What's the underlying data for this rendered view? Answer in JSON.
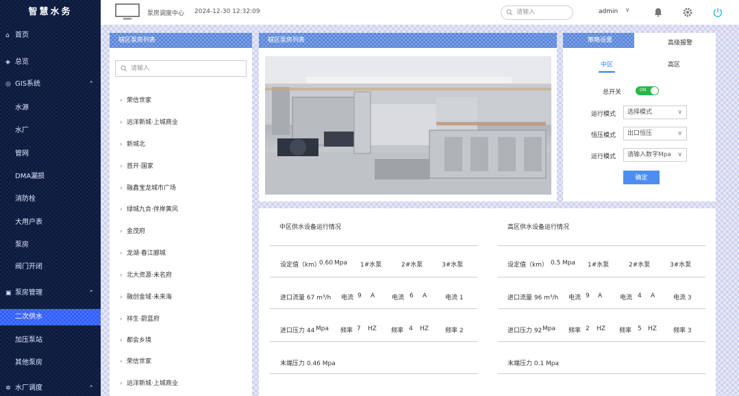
{
  "app": {
    "title": "智慧水务"
  },
  "sidebar": {
    "items": [
      {
        "label": "首页",
        "icon": "home-icon",
        "glyph": "⌂"
      },
      {
        "label": "总览",
        "icon": "layers-icon",
        "glyph": "◈"
      },
      {
        "label": "GIS系统",
        "icon": "map-icon",
        "glyph": "◎",
        "arrow": "⌃"
      },
      {
        "label": "水源"
      },
      {
        "label": "水厂"
      },
      {
        "label": "管网"
      },
      {
        "label": "DMA漏损"
      },
      {
        "label": "消防栓"
      },
      {
        "label": "大用户表"
      },
      {
        "label": "泵房"
      },
      {
        "label": "阀门开闭"
      },
      {
        "label": "泵房管理",
        "icon": "pump-icon",
        "glyph": "▣",
        "arrow": "⌃"
      },
      {
        "label": "二次供水"
      },
      {
        "label": "加压泵站"
      },
      {
        "label": "其他泵房"
      },
      {
        "label": "水厂调度",
        "icon": "settings-icon",
        "glyph": "✲",
        "arrow": "⌃"
      }
    ]
  },
  "header": {
    "title": "泵房调度中心",
    "datetime": "2024-12-30 12:32:09",
    "search_placeholder": "请输入",
    "user": "admin",
    "user_arrow": "∨"
  },
  "tree": {
    "header": "辖区泵房列表",
    "search_placeholder": "请输入",
    "items": [
      "荣信世家",
      "远洋新城·上城商业",
      "新城北",
      "首开·国家",
      "融鑫宝龙城市广场",
      "绿城九合·伴岸黄风",
      "金茂府",
      "龙湖·春江郦城",
      "北大资源·未名府",
      "融创金域·未来海",
      "祥生·蔚蓝府",
      "都会乡境",
      "荣信世家",
      "远洋新城·上城商业"
    ]
  },
  "photo_panel": {
    "header": "辖区泵房列表"
  },
  "settings": {
    "tab_left": "策略设置",
    "tab_right": "高级报警",
    "zone_mid": "中区",
    "zone_high": "高区",
    "master_switch": "总开关",
    "toggle_on": "ON",
    "run_mode_label": "运行模式",
    "run_mode_value": "选择模式",
    "pressure_mode_label": "恒压模式",
    "pressure_mode_value": "出口恒压",
    "run_mode2_label": "运行模式",
    "run_mode2_value": "请输入数字Mpa",
    "confirm": "确定",
    "chev": "∨"
  },
  "status": {
    "mid": {
      "title": "中区供水设备运行情况",
      "set_pressure": "设定值（km）",
      "set_pressure_val": "0.60",
      "set_pressure_unit": "Mpa",
      "pump1": "1#水泵",
      "pump2": "2#水泵",
      "pump3": "3#水泵",
      "inflow": "进口流量 67 m³/h",
      "cur1_label": "电流",
      "cur1_val": "9",
      "cur1_unit": "A",
      "cur2_label": "电流",
      "cur2_val": "6",
      "cur2_unit": "A",
      "cur3": "电流 1",
      "inpress": "进口压力 44",
      "inpress_unit": "Mpa",
      "f1_label": "频率",
      "f1_val": "7",
      "f1_unit": "HZ",
      "f2_label": "频率",
      "f2_val": "4",
      "f2_unit": "HZ",
      "f3": "频率 2",
      "outpress": "末端压力 0.46 Mpa"
    },
    "high": {
      "title": "高区供水设备运行情况",
      "set_pressure": "设定值（km）",
      "set_pressure_val": "0.5",
      "set_pressure_unit": "Mpa",
      "pump1": "1#水泵",
      "pump2": "2#水泵",
      "pump3": "3#水泵",
      "inflow": "进口流量 96 m³/h",
      "cur1_label": "电流",
      "cur1_val": "9",
      "cur1_unit": "A",
      "cur2_label": "电流",
      "cur2_val": "4",
      "cur2_unit": "A",
      "cur3": "电流 3",
      "inpress": "进口压力 92",
      "inpress_unit": "Mpa",
      "f1_label": "频率",
      "f1_val": "2",
      "f1_unit": "HZ",
      "f2_label": "频率",
      "f2_val": "5",
      "f2_unit": "HZ",
      "f3": "频率 3",
      "outpress": "末端压力 0.1 Mpa"
    }
  },
  "colors": {
    "accent": "#2e5bff",
    "panel_header": "#5b86d6",
    "toggle_on": "#27b84a",
    "button": "#4d8ef0"
  }
}
